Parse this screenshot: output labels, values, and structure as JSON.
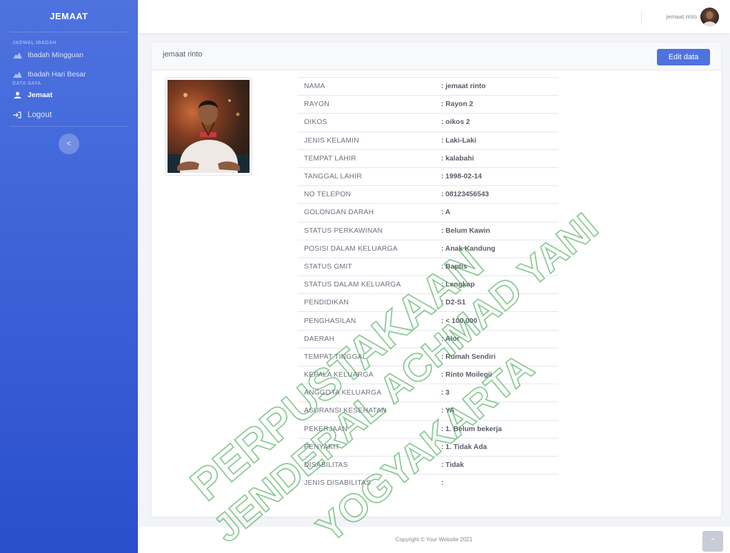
{
  "sidebar": {
    "brand": "JEMAAT",
    "section_jadwal": "JADWAL IBADAH",
    "items": [
      {
        "label": "Ibadah Mingguan",
        "icon": "church-icon"
      },
      {
        "label": "Ibadah Hari Besar",
        "icon": "church-icon"
      }
    ],
    "section_data": "DATA SAYA",
    "jemaat_label": "Jemaat",
    "logout_label": "Logout",
    "toggle": "<"
  },
  "topbar": {
    "user_name": "jemaat rinto"
  },
  "card": {
    "title": "jemaat rinto",
    "edit_label": "Edit data"
  },
  "details": [
    {
      "label": "NAMA",
      "value": ": jemaat rinto"
    },
    {
      "label": "RAYON",
      "value": ": Rayon 2"
    },
    {
      "label": "OIKOS",
      "value": ": oikos 2"
    },
    {
      "label": "JENIS KELAMIN",
      "value": ": Laki-Laki"
    },
    {
      "label": "TEMPAT LAHIR",
      "value": ": kalabahi"
    },
    {
      "label": "TANGGAL LAHIR",
      "value": ": 1998-02-14"
    },
    {
      "label": "NO TELEPON",
      "value": ": 08123456543"
    },
    {
      "label": "GOLONGAN DARAH",
      "value": ": A"
    },
    {
      "label": "STATUS PERKAWINAN",
      "value": ": Belum Kawin"
    },
    {
      "label": "POSISI DALAM KELUARGA",
      "value": ": Anak Kandung"
    },
    {
      "label": "STATUS GMIT",
      "value": ": Baptis"
    },
    {
      "label": "STATUS DALAM KELUARGA",
      "value": ": Lengkap"
    },
    {
      "label": "PENDIDIKAN",
      "value": ": D2-S1"
    },
    {
      "label": "PENGHASILAN",
      "value": ": < 100.000"
    },
    {
      "label": "DAERAH",
      "value": ": Alor"
    },
    {
      "label": "TEMPAT TINGGAL",
      "value": ": Rumah Sendiri"
    },
    {
      "label": "KEPALA KELUARGA",
      "value": ": Rinto Moilegii"
    },
    {
      "label": "ANGGOTA KELUARGA",
      "value": ": 3"
    },
    {
      "label": "ASURANSI KESEHATAN",
      "value": ": YA"
    },
    {
      "label": "PEKERJAAN",
      "value": ": 1. Belum bekerja"
    },
    {
      "label": "PENYAKIT",
      "value": ": 1. Tidak Ada"
    },
    {
      "label": "DISABILITAS",
      "value": ": Tidak"
    },
    {
      "label": "JENIS DISABILITAS",
      "value": ":"
    }
  ],
  "footer": {
    "copyright": "Copyright © Your Website 2021"
  },
  "watermark": {
    "lines": [
      "PERPUSTAKAAN",
      "JENDERAL ACHMAD YANI",
      "YOGYAKARTA"
    ],
    "color": "#2e9e3c"
  },
  "colors": {
    "primary": "#4e73df",
    "sidebar_dark": "#2a4fcc"
  }
}
